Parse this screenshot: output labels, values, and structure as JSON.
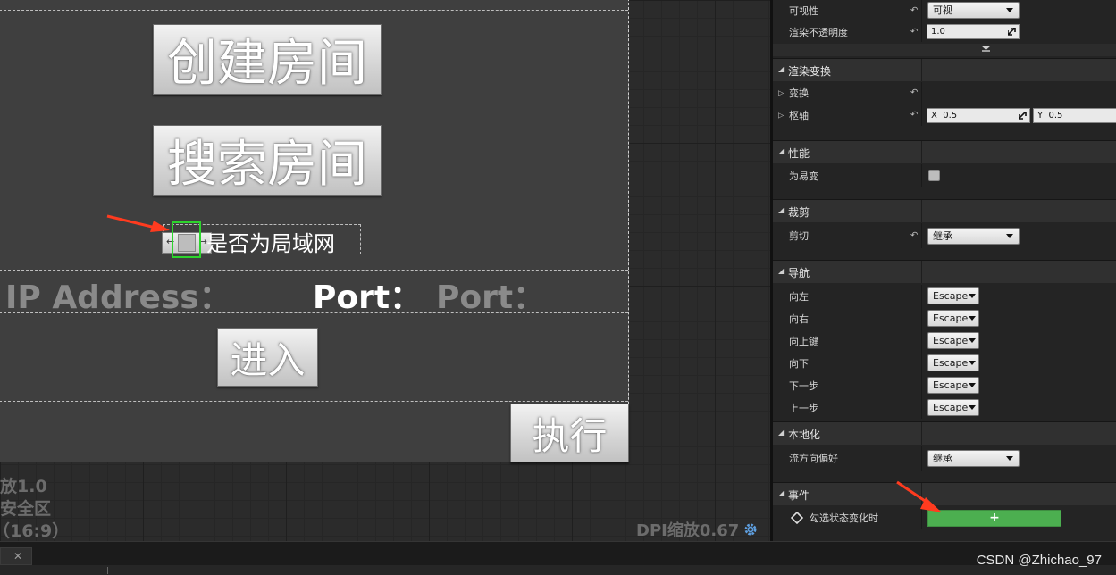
{
  "designer": {
    "create_room_label": "创建房间",
    "search_room_label": "搜索房间",
    "lan_checkbox_label": "是否为局域网",
    "ip_label": "IP Address：",
    "port_label": "Port：",
    "port_placeholder": "Port：",
    "enter_label": "进入",
    "execute_label": "执行",
    "zoom_text": "放1.0",
    "safe_zone_text": "安全区",
    "aspect_text": "（16:9）",
    "dpi_text": "DPI缩放0.67",
    "settings_icon": "gear-icon",
    "arrow_color": "#ff3b1f"
  },
  "bottom": {
    "close_glyph": "✕",
    "watermark": "CSDN @Zhichao_97"
  },
  "details": {
    "visibility": {
      "label": "可视性",
      "value": "可视"
    },
    "render_opacity": {
      "label": "渲染不透明度",
      "value": "1.0"
    },
    "render_transform": {
      "title": "渲染变换",
      "transform_label": "变换",
      "pivot_label": "枢轴",
      "pivot_x_prefix": "X",
      "pivot_x": "0.5",
      "pivot_y_prefix": "Y",
      "pivot_y": "0.5"
    },
    "performance": {
      "title": "性能",
      "volatile_label": "为易变",
      "volatile_checked": false
    },
    "clipping": {
      "title": "裁剪",
      "clipping_label": "剪切",
      "clipping_value": "继承"
    },
    "navigation": {
      "title": "导航",
      "rows": [
        {
          "label": "向左",
          "value": "Escape"
        },
        {
          "label": "向右",
          "value": "Escape"
        },
        {
          "label": "向上键",
          "value": "Escape"
        },
        {
          "label": "向下",
          "value": "Escape"
        },
        {
          "label": "下一步",
          "value": "Escape"
        },
        {
          "label": "上一步",
          "value": "Escape"
        }
      ]
    },
    "localization": {
      "title": "本地化",
      "flow_label": "流方向偏好",
      "flow_value": "继承"
    },
    "events": {
      "title": "事件",
      "check_changed_label": "勾选状态变化时",
      "add_glyph": "+"
    },
    "colors": {
      "add_button": "#4caf50",
      "panel_bg": "#242424"
    }
  }
}
